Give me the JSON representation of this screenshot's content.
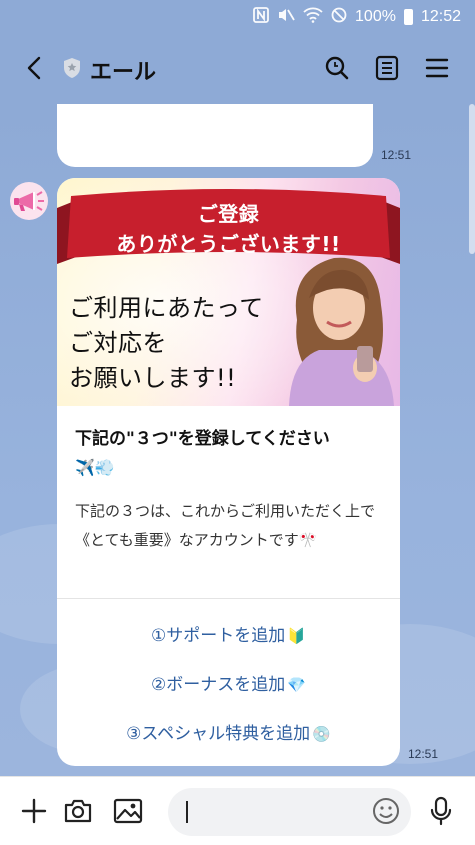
{
  "status_bar": {
    "battery": "100%",
    "time": "12:52",
    "icons": [
      "nfc-icon",
      "mute-icon",
      "wifi-icon",
      "blocked-icon",
      "battery-icon"
    ]
  },
  "header": {
    "title": "エール",
    "icons": [
      "back-icon",
      "shield-badge-icon",
      "search-icon",
      "notes-icon",
      "menu-icon"
    ]
  },
  "chat": {
    "previous_time": "12:51",
    "card": {
      "banner_line1": "ご登録",
      "banner_line2": "ありがとうございます!!",
      "hero_lines": [
        "ご利用にあたって",
        "ご対応を",
        "お願いします!!"
      ],
      "title": "下記の\"３つ\"を登録してください",
      "title_emojis": "✈️💨",
      "description": "下記の３つは、これからご利用いただく上で《とても重要》なアカウントです🎌",
      "links": [
        {
          "label": "①サポートを追加",
          "emoji": "🔰"
        },
        {
          "label": "②ボーナスを追加",
          "emoji": "💎"
        },
        {
          "label": "③スペシャル特典を追加",
          "emoji": "💿"
        }
      ],
      "time": "12:51"
    }
  },
  "input_bar": {
    "placeholder": "",
    "icons": [
      "plus-icon",
      "camera-icon",
      "image-icon",
      "emoji-icon",
      "mic-icon"
    ]
  },
  "colors": {
    "background": "#8eaad6",
    "link": "#2f5fa0",
    "banner_red": "#c71f2d",
    "accent_pink": "#e64ba3"
  }
}
